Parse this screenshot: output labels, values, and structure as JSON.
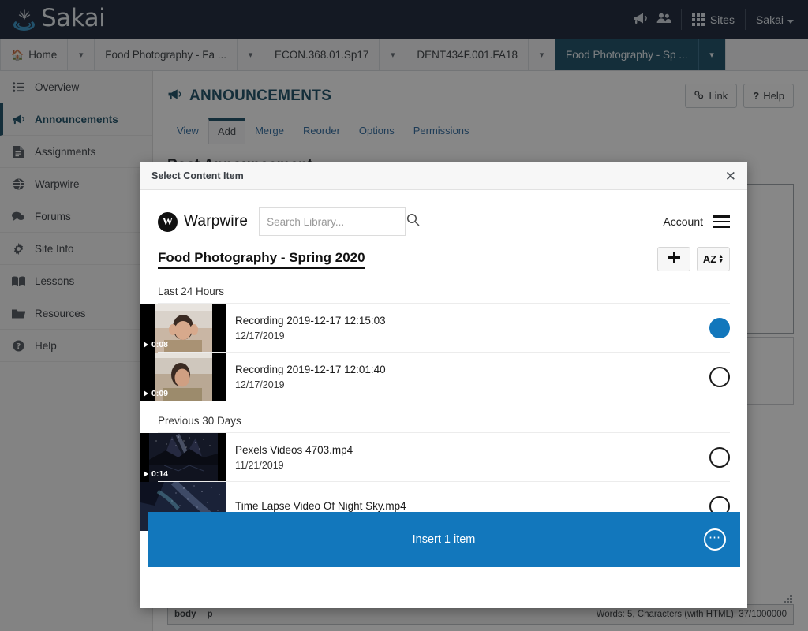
{
  "app": {
    "brand": "Sakai",
    "header": {
      "announcements_icon": "megaphone-icon",
      "members_icon": "users-icon",
      "sites_label": "Sites",
      "sites_icon": "grid-icon",
      "user_label": "Sakai",
      "user_caret_icon": "chevron-down-icon"
    },
    "site_tabs": [
      {
        "label": "Home",
        "icon": "home-icon",
        "active": false
      },
      {
        "label": "Food Photography - Fa ...",
        "icon": "",
        "active": false
      },
      {
        "label": "ECON.368.01.Sp17",
        "icon": "",
        "active": false
      },
      {
        "label": "DENT434F.001.FA18",
        "icon": "",
        "active": false
      },
      {
        "label": "Food Photography - Sp ...",
        "icon": "",
        "active": true
      }
    ],
    "tools": [
      {
        "label": "Overview",
        "icon": "list-icon",
        "active": false
      },
      {
        "label": "Announcements",
        "icon": "megaphone-icon",
        "active": true
      },
      {
        "label": "Assignments",
        "icon": "document-icon",
        "active": false
      },
      {
        "label": "Warpwire",
        "icon": "globe-icon",
        "active": false
      },
      {
        "label": "Forums",
        "icon": "chat-icon",
        "active": false
      },
      {
        "label": "Site Info",
        "icon": "gear-icon",
        "active": false
      },
      {
        "label": "Lessons",
        "icon": "book-icon",
        "active": false
      },
      {
        "label": "Resources",
        "icon": "folder-icon",
        "active": false
      },
      {
        "label": "Help",
        "icon": "question-circle-icon",
        "active": false
      }
    ],
    "page": {
      "title": "ANNOUNCEMENTS",
      "title_icon": "megaphone-icon",
      "link_button": "Link",
      "link_icon": "link-icon",
      "help_button": "Help",
      "help_icon": "question-icon",
      "tabs": [
        {
          "label": "View",
          "selected": false
        },
        {
          "label": "Add",
          "selected": true
        },
        {
          "label": "Merge",
          "selected": false
        },
        {
          "label": "Reorder",
          "selected": false
        },
        {
          "label": "Options",
          "selected": false
        },
        {
          "label": "Permissions",
          "selected": false
        }
      ],
      "section_heading": "Post Announcement",
      "editor_status": {
        "path_body": "body",
        "path_element": "p",
        "counter": "Words: 5, Characters (with HTML): 37/1000000"
      }
    }
  },
  "modal": {
    "title": "Select Content Item",
    "close_icon": "close-icon",
    "warpwire": {
      "logo_letter": "W",
      "logo_icon": "warpwire-logo-icon",
      "name": "Warpwire",
      "search_placeholder": "Search Library...",
      "search_value": "",
      "search_icon": "search-icon",
      "account_label": "Account",
      "menu_icon": "hamburger-icon"
    },
    "library": {
      "title": "Food Photography - Spring 2020",
      "add_button_icon": "plus-icon",
      "sort_button_icon": "sort-az-icon",
      "sort_button_label": "AZ"
    },
    "groups": [
      {
        "label": "Last 24 Hours",
        "items": [
          {
            "name": "Recording 2019-12-17 12:15:03",
            "date": "12/17/2019",
            "duration": "0:08",
            "selected": true,
            "thumb": "person-portrait"
          },
          {
            "name": "Recording 2019-12-17 12:01:40",
            "date": "12/17/2019",
            "duration": "0:09",
            "selected": false,
            "thumb": "person-portrait"
          }
        ]
      },
      {
        "label": "Previous 30 Days",
        "items": [
          {
            "name": "Pexels Videos 4703.mp4",
            "date": "11/21/2019",
            "duration": "0:14",
            "selected": false,
            "thumb": "night-sky"
          },
          {
            "name": "Time Lapse Video Of Night Sky.mp4",
            "date": "",
            "duration": "",
            "selected": false,
            "thumb": "night-sky"
          }
        ]
      }
    ],
    "insert_bar": {
      "label": "Insert 1 item",
      "more_icon": "ellipsis-icon"
    }
  },
  "colors": {
    "sakai_navy": "#0f1a2e",
    "sakai_teal": "#10455e",
    "accent_blue": "#1277bc",
    "link_blue": "#25639b"
  }
}
